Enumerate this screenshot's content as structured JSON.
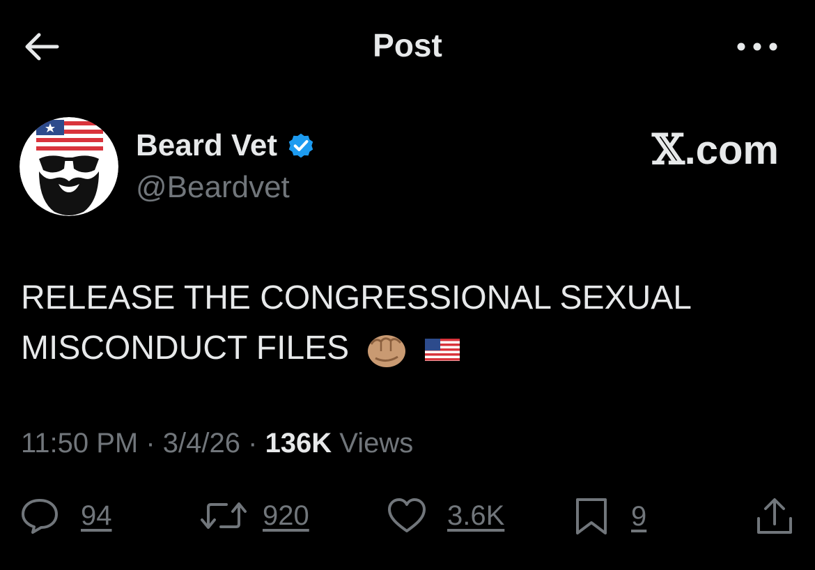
{
  "header": {
    "title": "Post",
    "back_icon": "arrow-left-icon",
    "more_icon": "ellipsis-icon"
  },
  "author": {
    "display_name": "Beard Vet",
    "handle": "@Beardvet",
    "verified_icon": "verified-badge-icon",
    "verified_color": "#1d9bf0"
  },
  "brand": {
    "x": "𝕏",
    "suffix": ".com"
  },
  "post": {
    "line1": "RELEASE THE CONGRESSIONAL SEXUAL",
    "line2": "MISCONDUCT FILES",
    "emojis": [
      "oncoming-fist-emoji",
      "us-flag-emoji"
    ]
  },
  "meta": {
    "time": "11:50 PM",
    "date": "3/4/26",
    "separator": " · ",
    "views_count": "136K",
    "views_label": " Views"
  },
  "actions": {
    "replies": "94",
    "reposts": "920",
    "likes": "3.6K",
    "bookmarks": "9"
  },
  "colors": {
    "background": "#000000",
    "text": "#e7e9ea",
    "muted": "#71767b",
    "accent": "#1d9bf0"
  }
}
